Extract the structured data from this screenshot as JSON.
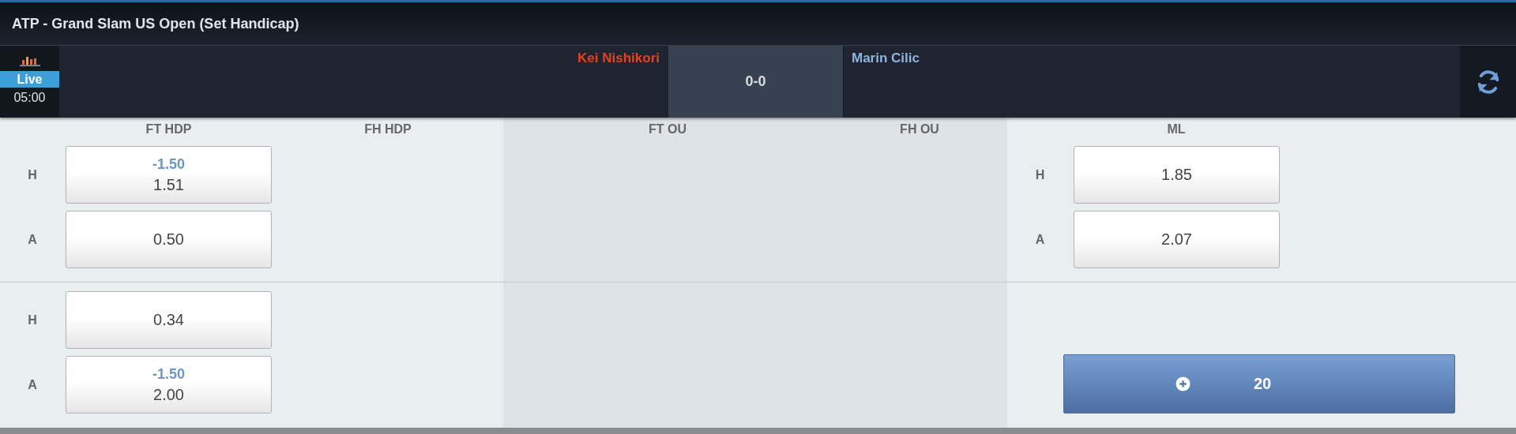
{
  "title": "ATP - Grand Slam US Open (Set Handicap)",
  "match": {
    "status": "Live",
    "time": "05:00",
    "home": "Kei Nishikori",
    "score": "0-0",
    "away": "Marin Cilic"
  },
  "columns": [
    {
      "label": "FT HDP"
    },
    {
      "label": "FH HDP"
    },
    {
      "label": "FT OU"
    },
    {
      "label": "FH OU"
    },
    {
      "label": "ML"
    }
  ],
  "blocks": [
    {
      "rows": [
        {
          "label": "H",
          "ft_hdp": {
            "line": "-1.50",
            "odds": "1.51"
          },
          "ml": {
            "label": "H",
            "odds": "1.85"
          }
        },
        {
          "label": "A",
          "ft_hdp": {
            "odds": "0.50"
          },
          "ml": {
            "label": "A",
            "odds": "2.07"
          }
        }
      ]
    },
    {
      "rows": [
        {
          "label": "H",
          "ft_hdp": {
            "odds": "0.34"
          }
        },
        {
          "label": "A",
          "ft_hdp": {
            "line": "-1.50",
            "odds": "2.00"
          }
        }
      ],
      "more_button": {
        "label": "20"
      }
    }
  ]
}
